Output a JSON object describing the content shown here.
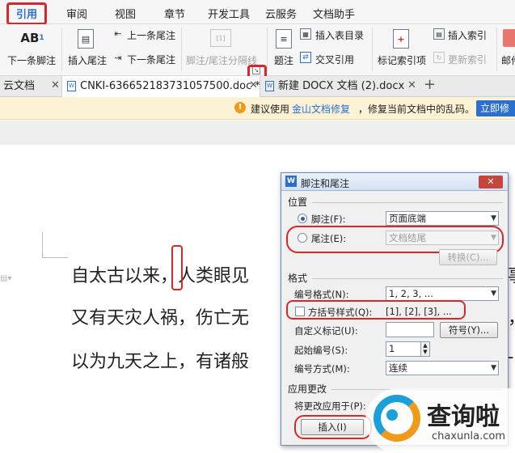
{
  "menubar": {
    "items": [
      "引用",
      "审阅",
      "视图",
      "章节",
      "开发工具",
      "云服务",
      "文档助手"
    ],
    "active": "引用"
  },
  "ribbon": {
    "next_footnote": "下一条脚注",
    "insert_endnote": "插入尾注",
    "prev_endnote": "上一条尾注",
    "next_endnote": "下一条尾注",
    "separator": "脚注/尾注分隔线",
    "caption": "题注",
    "insert_toc": "插入表目录",
    "cross_ref": "交叉引用",
    "mark_index": "标记索引项",
    "insert_index": "插入索引",
    "update_index": "更新索引",
    "mail": "邮件",
    "ab_icon": "AB",
    "ab_sup": "1"
  },
  "tabs": {
    "cloud": "云文档",
    "doc1": "CNKI-636652183731057500.doc *",
    "doc2": "新建 DOCX 文档 (2).docx",
    "plus": "+"
  },
  "notice": {
    "prefix": "建议使用",
    "link": "金山文档修复",
    "suffix": "，修复当前文档中的乱码。",
    "button": "立即修"
  },
  "document": {
    "lines": [
      "自太古以来，人类眼见",
      "又有天灾人祸，伤亡无",
      "以为九天之上，有诸般"
    ],
    "edge_chars": [
      "事",
      "，",
      "-"
    ]
  },
  "dialog": {
    "title": "脚注和尾注",
    "position_label": "位置",
    "footnote_label": "脚注(F):",
    "footnote_value": "页面底端",
    "endnote_label": "尾注(E):",
    "endnote_value": "文档结尾",
    "convert_button": "转换(C)...",
    "format_label": "格式",
    "number_format_label": "编号格式(N):",
    "number_format_value": "1, 2, 3, ...",
    "bracket_label": "方括号样式(Q):",
    "bracket_value": "[1], [2], [3], ...",
    "custom_mark_label": "自定义标记(U):",
    "custom_mark_value": "",
    "symbol_button": "符号(Y)...",
    "start_label": "起始编号(S):",
    "start_value": "1",
    "numbering_label": "编号方式(M):",
    "numbering_value": "连续",
    "apply_label": "应用更改",
    "apply_to_label": "将更改应用于(P):",
    "insert_button": "插入(I)"
  },
  "watermark": {
    "text": "查询啦",
    "url": "chaxunla.com"
  },
  "colors": {
    "accent": "#2b6fd0",
    "highlight": "#d9262d",
    "notice_bg": "#fcf2d5",
    "orange": "#f09a1a"
  }
}
